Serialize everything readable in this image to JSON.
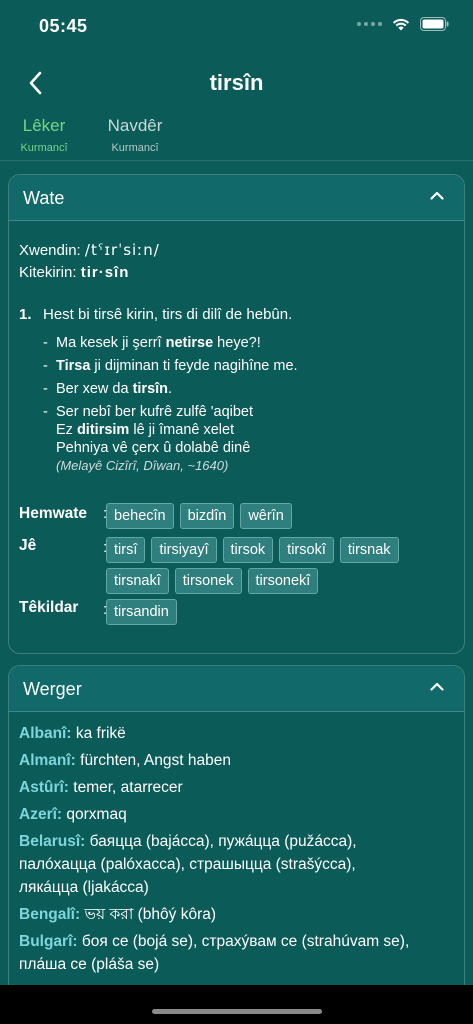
{
  "status_bar": {
    "time": "05:45"
  },
  "header": {
    "title": "tirsîn"
  },
  "tabs": [
    {
      "label": "Lêker",
      "sub": "Kurmancî"
    },
    {
      "label": "Navdêr",
      "sub": "Kurmancî"
    }
  ],
  "meaning": {
    "title": "Wate",
    "pronunciation_label": "Xwendin:",
    "pronunciation": "/tˁɪrˈsiːn/",
    "syllables_label": "Kitekirin:",
    "syllables": "tir·sîn",
    "sense_number": "1.",
    "sense_text": "Hest bi tirsê kirin, tirs di dilî de hebûn.",
    "examples": [
      {
        "pre": "Ma kesek ji şerrî ",
        "bold": "netirse",
        "post": " heye?!"
      },
      {
        "pre": "",
        "bold": "Tirsa",
        "post": " ji dijminan ti feyde nagihîne me."
      },
      {
        "pre": "Ber xew da ",
        "bold": "tirsîn",
        "post": "."
      },
      {
        "line1": "Ser nebî ber kufrê zulfê 'aqibet",
        "line2_pre": "Ez ",
        "line2_bold": "ditirsim",
        "line2_post": " lê ji îmanê xelet",
        "line3": "Pehniya vê çerx û dolabê dinê",
        "citation": "(Melayê Cizîrî, Dîwan, ~1640)"
      }
    ],
    "synonyms_label": "Hemwate",
    "synonyms": [
      "behecîn",
      "bizdîn",
      "wêrîn"
    ],
    "forms_label": "Jê",
    "forms": [
      "tirsî",
      "tirsiyayî",
      "tirsok",
      "tirsokî",
      "tirsnak",
      "tirsnakî",
      "tirsonek",
      "tirsonekî"
    ],
    "causative_label": "Têkildar",
    "causative": [
      "tirsandin"
    ],
    "colon": ":"
  },
  "translations": {
    "title": "Werger",
    "rows": [
      {
        "lang": "Albanî:",
        "text": "ka frikë"
      },
      {
        "lang": "Almanî:",
        "text": "fürchten,  Angst haben"
      },
      {
        "lang": "Astûrî:",
        "text": "temer,  atarrecer"
      },
      {
        "lang": "Azerî:",
        "text": "qorxmaq"
      },
      {
        "lang": "Belarusî:",
        "text": "баяцца (bajácca),  пужáцца (pužácca),",
        "text2": "палóхацца (palóxacca),  страшыцца (strašýcca),",
        "text3": "лякáцца (ljakácca)"
      },
      {
        "lang": "Bengalî:",
        "text": "ভয় করা (bhôý kôra)"
      },
      {
        "lang": "Bulgarî:",
        "text": "боя се (bojá se),  страхýвам се (strahúvam se),",
        "text2": "пла́ша се (pláša se)"
      }
    ]
  }
}
